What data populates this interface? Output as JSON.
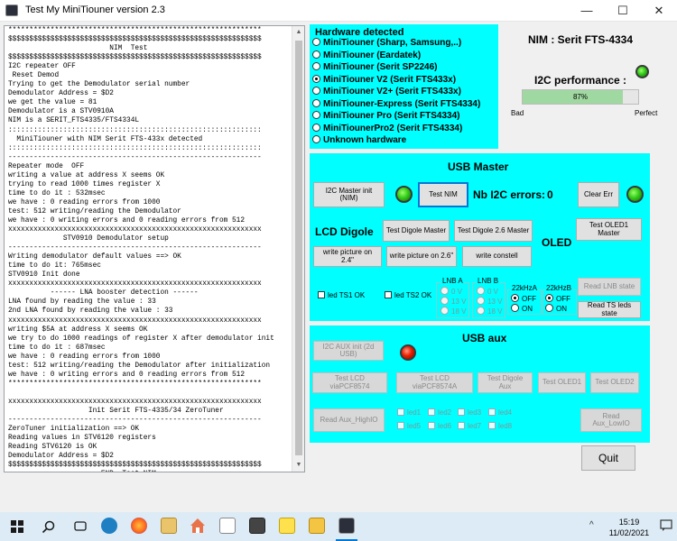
{
  "window": {
    "title": "Test My MiniTiouner version 2.3",
    "minimize": "—",
    "maximize": "☐",
    "close": "✕"
  },
  "log": {
    "text": "************************************************************\n$$$$$$$$$$$$$$$$$$$$$$$$$$$$$$$$$$$$$$$$$$$$$$$$$$$$$$$$$$$$\n                        NIM  Test\n$$$$$$$$$$$$$$$$$$$$$$$$$$$$$$$$$$$$$$$$$$$$$$$$$$$$$$$$$$$$\nI2C repeater OFF\n Reset Demod\nTrying to get the Demodulator serial number\nDemodulator Address = $D2\nwe get the value = 81\nDemodulator is a STV0910A\nNIM is a SERIT_FTS4335/FTS4334L\n::::::::::::::::::::::::::::::::::::::::::::::::::::::::::::\n  MiniTiouner with NIM Serit FTS-433x detected\n::::::::::::::::::::::::::::::::::::::::::::::::::::::::::::\n------------------------------------------------------------\nRepeater mode  OFF\nwriting a value at address X seems OK\ntrying to read 1000 times register X\ntime to do it : 532msec\nwe have : 0 reading errors from 1000\ntest: 512 writing/reading the Demodulator\nwe have : 0 writing errors and 0 reading errors from 512\nxxxxxxxxxxxxxxxxxxxxxxxxxxxxxxxxxxxxxxxxxxxxxxxxxxxxxxxxxxxx\n             STV0910 Demodulator setup\n------------------------------------------------------------\nWriting demodulator default values ==> OK\ntime to do it: 765msec\nSTV0910 Init done\nxxxxxxxxxxxxxxxxxxxxxxxxxxxxxxxxxxxxxxxxxxxxxxxxxxxxxxxxxxxx\n          ------ LNA booster detection ------\nLNA found by reading the value : 33\n2nd LNA found by reading the value : 33\nxxxxxxxxxxxxxxxxxxxxxxxxxxxxxxxxxxxxxxxxxxxxxxxxxxxxxxxxxxxx\nwriting $5A at address X seems OK\nwe try to do 1000 readings of register X after demodulator init\ntime to do it : 687msec\nwe have : 0 reading errors from 1000\ntest: 512 writing/reading the Demodulator after initialization\nwe have : 0 writing errors and 0 reading errors from 512\n************************************************************\n\nxxxxxxxxxxxxxxxxxxxxxxxxxxxxxxxxxxxxxxxxxxxxxxxxxxxxxxxxxxxx\n                   Init Serit FTS-4335/34 ZeroTuner\n------------------------------------------------------------\nZeroTuner initialization ==> OK\nReading values in STV6120 registers\nReading STV6120 is OK\nDemodulator Address = $D2\n$$$$$$$$$$$$$$$$$$$$$$$$$$$$$$$$$$$$$$$$$$$$$$$$$$$$$$$$$$$$\n                      END  Test NIM\n$$$$$$$$$$$$$$$$$$$$$$$$$$$$$$$$$$$$$$$$$$$$$$$$$$$$$$$$$$$$"
  },
  "hardware": {
    "title": "Hardware detected",
    "options": [
      {
        "label": "MiniTiouner (Sharp, Samsung,..)",
        "selected": false
      },
      {
        "label": "MiniTiouner (Eardatek)",
        "selected": false
      },
      {
        "label": "MiniTiouner (Serit SP2246)",
        "selected": false
      },
      {
        "label": "MiniTiouner V2 (Serit FTS433x)",
        "selected": true
      },
      {
        "label": "MiniTiouner V2+ (Serit FTS433x)",
        "selected": false
      },
      {
        "label": "MiniTiouner-Express (Serit FTS4334)",
        "selected": false
      },
      {
        "label": "MiniTiouner Pro  (Serit FTS4334)",
        "selected": false
      },
      {
        "label": "MiniTiounerPro2 (Serit FTS4334)",
        "selected": false
      },
      {
        "label": "Unknown hardware",
        "selected": false
      }
    ]
  },
  "nim": {
    "title": "NIM :  Serit FTS-4334",
    "i2c_perf_label": "I2C performance :",
    "progress_percent": 87,
    "progress_text": "87%",
    "bad_label": "Bad",
    "perfect_label": "Perfect",
    "led_color": "#33cc1a"
  },
  "usb_master": {
    "title": "USB Master",
    "i2c_master_init": "I2C Master init (NIM)",
    "test_nim": "Test NIM",
    "nb_i2c_errors_label": "Nb I2C errors:",
    "nb_i2c_errors_value": "0",
    "clear_err": "Clear Err",
    "lcd_digole_label": "LCD Digole",
    "test_digole_master": "Test Digole Master",
    "test_digole_26_master": "Test Digole 2.6 Master",
    "test_oled1_master": "Test OLED1 Master",
    "oled_label": "OLED",
    "write_picture_24": "write picture on 2.4\"",
    "write_picture_26": "write picture on 2.6\"",
    "write_constell": "write constell",
    "led_ts1_ok": "led TS1 OK",
    "led_ts2_ok": "led TS2 OK",
    "lnb_a": {
      "title": "LNB A",
      "options": [
        "0 V",
        "13 V",
        "18 V"
      ]
    },
    "lnb_b": {
      "title": "LNB B",
      "options": [
        "0 V",
        "13 V",
        "18 V"
      ]
    },
    "khz_a": {
      "title": "22kHzA",
      "options": [
        "OFF",
        "ON"
      ],
      "selected": "OFF"
    },
    "khz_b": {
      "title": "22kHzB",
      "options": [
        "OFF",
        "ON"
      ],
      "selected": "OFF"
    },
    "read_lnb_state": "Read LNB state",
    "read_ts_leds_state": "Read TS leds state"
  },
  "usb_aux": {
    "title": "USB aux",
    "i2c_aux_init": "I2C AUX init (2d USB)",
    "led_color": "#e82000",
    "test_lcd_8574": "Test LCD viaPCF8574",
    "test_lcd_8574a": "Test LCD viaPCF8574A",
    "test_digole_aux": "Test Digole Aux",
    "test_oled1": "Test OLED1",
    "test_oled2": "Test OLED2",
    "read_aux_high": "Read Aux_HighIO",
    "read_aux_low": "Read Aux_LowIO",
    "leds_row1": [
      "led1",
      "led2",
      "led3",
      "led4"
    ],
    "leds_row2": [
      "led5",
      "led6",
      "led7",
      "led8"
    ]
  },
  "quit_label": "Quit",
  "taskbar": {
    "time": "15:19",
    "date": "11/02/2021",
    "chevron": "^",
    "icons": [
      "start-icon",
      "search-icon",
      "task-view-icon",
      "edge-icon",
      "firefox-icon",
      "file-explorer-icon",
      "home-icon",
      "document-icon",
      "calculator-icon",
      "sticky-notes-icon",
      "folder-icon",
      "minitiouner-icon"
    ],
    "accent": "#0078d7"
  }
}
